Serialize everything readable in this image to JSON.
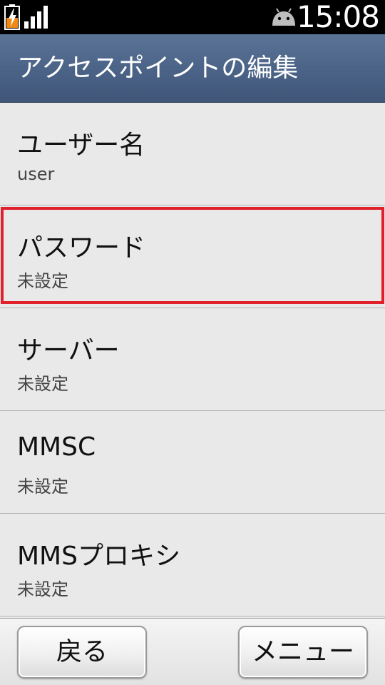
{
  "status_bar": {
    "time": "15:08",
    "icons": [
      "battery-charging-icon",
      "signal-strength-icon",
      "android-icon"
    ]
  },
  "title_bar": {
    "title": "アクセスポイントの編集"
  },
  "settings": [
    {
      "name": "ユーザー名",
      "value": "user"
    },
    {
      "name": "パスワード",
      "value": "未設定"
    },
    {
      "name": "サーバー",
      "value": "未設定"
    },
    {
      "name": "MMSC",
      "value": "未設定"
    },
    {
      "name": "MMSプロキシ",
      "value": "未設定"
    }
  ],
  "bottom_bar": {
    "back_label": "戻る",
    "menu_label": "メニュー"
  },
  "colors": {
    "title_bar": "#4c6488",
    "highlight": "#e0202a",
    "background": "#e9e9e9"
  }
}
